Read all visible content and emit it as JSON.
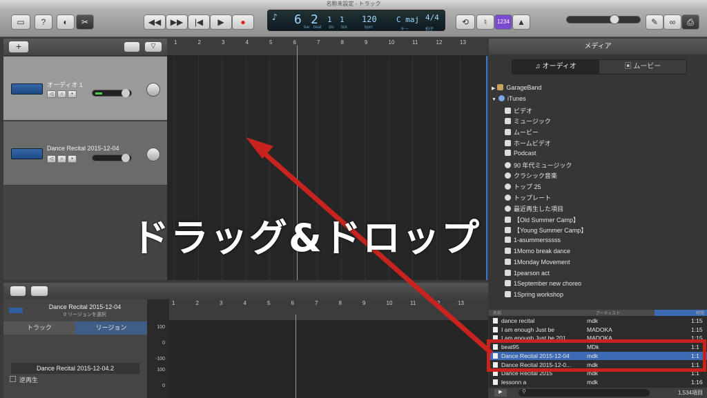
{
  "window": {
    "title": "名称未設定 - トラック"
  },
  "toolbar": {
    "lcd": {
      "beat_icon": "♪",
      "bar": "6",
      "beat": "2",
      "div": "1",
      "tick": "1",
      "tempo": "120",
      "key": "C maj",
      "signature": "4/4",
      "bar_label": "bar",
      "beat_label": "beat",
      "div_label": "div",
      "tick_label": "tick",
      "tempo_label": "bpm",
      "key_label": "キー",
      "signature_label": "拍子"
    },
    "count_in": "1234"
  },
  "tracks": [
    {
      "name": "オーディオ 1",
      "selected": true
    },
    {
      "name": "Dance Recital 2015-12-04",
      "selected": false
    }
  ],
  "ruler": {
    "numbers": [
      "1",
      "2",
      "3",
      "4",
      "5",
      "6",
      "7",
      "8",
      "9",
      "10",
      "11",
      "12",
      "13"
    ]
  },
  "editor": {
    "region_title": "Dance Recital 2015-12-04",
    "region_subtitle": "0 リージョンを選択",
    "tab_track": "トラック",
    "tab_region": "リージョン",
    "region_name": "Dance Recital 2015-12-04.2",
    "reverse_label": "逆再生",
    "y_labels": [
      "100",
      "0",
      "-100",
      "100",
      "0"
    ]
  },
  "media": {
    "header": "メディア",
    "tab_audio": "オーディオ",
    "tab_movie": "ムービー",
    "sources": [
      {
        "label": "GarageBand",
        "level": 0,
        "icon": "folder-icon",
        "disclosure": "▶"
      },
      {
        "label": "iTunes",
        "level": 0,
        "icon": "itunes-icon",
        "disclosure": "▼"
      },
      {
        "label": "ビデオ",
        "level": 1,
        "icon": "video-icon"
      },
      {
        "label": "ミュージック",
        "level": 1,
        "icon": "music-note-icon"
      },
      {
        "label": "ムービー",
        "level": 1,
        "icon": "film-icon"
      },
      {
        "label": "ホームビデオ",
        "level": 1,
        "icon": "film-icon"
      },
      {
        "label": "Podcast",
        "level": 1,
        "icon": "podcast-icon"
      },
      {
        "label": "90 年代ミュージック",
        "level": 1,
        "icon": "gear-icon"
      },
      {
        "label": "クラシック音楽",
        "level": 1,
        "icon": "gear-icon"
      },
      {
        "label": "トップ 25",
        "level": 1,
        "icon": "gear-icon"
      },
      {
        "label": "トップレート",
        "level": 1,
        "icon": "gear-icon"
      },
      {
        "label": "最近再生した項目",
        "level": 1,
        "icon": "gear-icon"
      },
      {
        "label": "【Old Summer Camp】",
        "level": 1,
        "icon": "playlist-icon"
      },
      {
        "label": "【Young Summer Camp】",
        "level": 1,
        "icon": "playlist-icon"
      },
      {
        "label": "1-asummersssss",
        "level": 1,
        "icon": "playlist-icon"
      },
      {
        "label": "1Momo break dance",
        "level": 1,
        "icon": "playlist-icon"
      },
      {
        "label": "1Monday Movement",
        "level": 1,
        "icon": "playlist-icon"
      },
      {
        "label": "1pearson act",
        "level": 1,
        "icon": "playlist-icon"
      },
      {
        "label": "1September new choreo",
        "level": 1,
        "icon": "playlist-icon"
      },
      {
        "label": "1Spring workshop",
        "level": 1,
        "icon": "playlist-icon"
      }
    ],
    "columns": {
      "name": "名前",
      "artist": "アーティスト",
      "time": "時間"
    },
    "rows": [
      {
        "name": "dance recital",
        "artist": "mdk",
        "time": "1:15",
        "selected": false
      },
      {
        "name": "I am enough Just be",
        "artist": "MADOKA",
        "time": "1:15",
        "selected": false
      },
      {
        "name": "I am enough Just be 201...",
        "artist": "MADOKA",
        "time": "1:15",
        "selected": false
      },
      {
        "name": "beat95",
        "artist": "MDk",
        "time": "1:1",
        "selected": false
      },
      {
        "name": "Dance Recital 2015-12-04",
        "artist": "mdk",
        "time": "1:1",
        "selected": true
      },
      {
        "name": "Dance Recital 2015-12-0...",
        "artist": "mdk",
        "time": "1:1",
        "selected": false
      },
      {
        "name": "Dance Recital 2015",
        "artist": "mdk",
        "time": "1:1",
        "selected": false
      },
      {
        "name": "lessonn a",
        "artist": "mdk",
        "time": "1:16",
        "selected": false
      }
    ],
    "count": "1,534項目"
  },
  "annotation": {
    "caption": "ドラッグ&ドロップ",
    "color": "#c8231e"
  }
}
